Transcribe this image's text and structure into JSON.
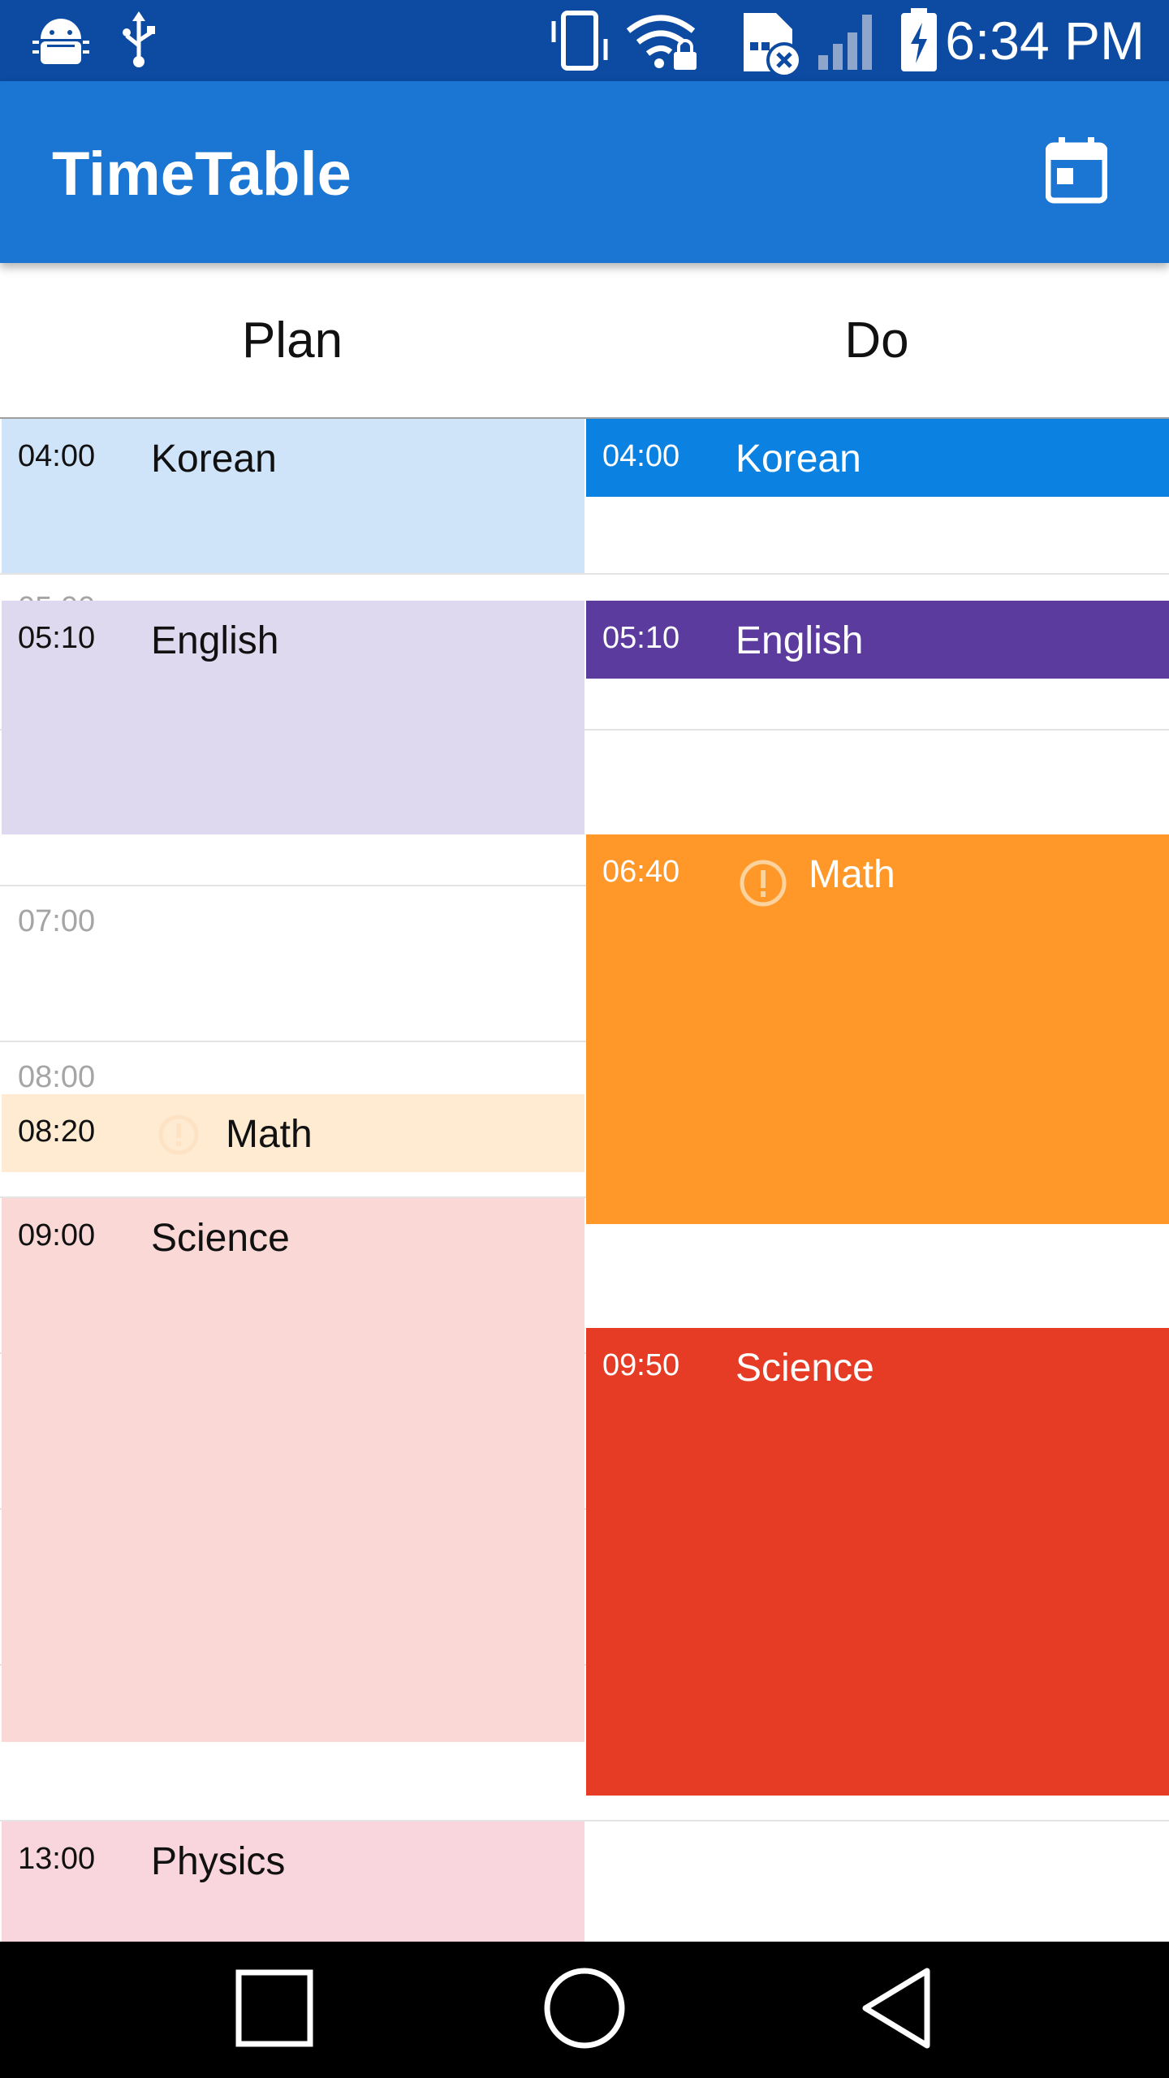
{
  "status_bar": {
    "time": "6:34 PM",
    "icons": [
      "android-debug-icon",
      "usb-icon",
      "vibrate-icon",
      "wifi-lock-icon",
      "sim-error-icon",
      "signal-icon",
      "battery-charging-icon"
    ]
  },
  "app_bar": {
    "title": "TimeTable",
    "action_icon": "calendar-today-icon"
  },
  "columns": {
    "plan": "Plan",
    "do": "Do"
  },
  "hour_labels": {
    "h05": "05:00",
    "h07": "07:00",
    "h08": "08:00"
  },
  "plan_events": [
    {
      "time": "04:00",
      "title": "Korean",
      "color": "#cfe3f9"
    },
    {
      "time": "05:10",
      "title": "English",
      "color": "#dfd9f0"
    },
    {
      "time": "08:20",
      "title": "Math",
      "color": "#ffebd2",
      "warning": true
    },
    {
      "time": "09:00",
      "title": "Science",
      "color": "#f9d8d6"
    },
    {
      "time": "13:00",
      "title": "Physics",
      "color": "#f9d5dd"
    }
  ],
  "do_events": [
    {
      "time": "04:00",
      "title": "Korean",
      "color": "#0b82e2"
    },
    {
      "time": "05:10",
      "title": "English",
      "color": "#5c3b9f"
    },
    {
      "time": "06:40",
      "title": "Math",
      "color": "#ff9829",
      "warning": true
    },
    {
      "time": "09:50",
      "title": "Science",
      "color": "#e63c25"
    }
  ],
  "nav_bar": {
    "icons": [
      "recents-square-icon",
      "home-circle-icon",
      "back-triangle-icon"
    ]
  }
}
